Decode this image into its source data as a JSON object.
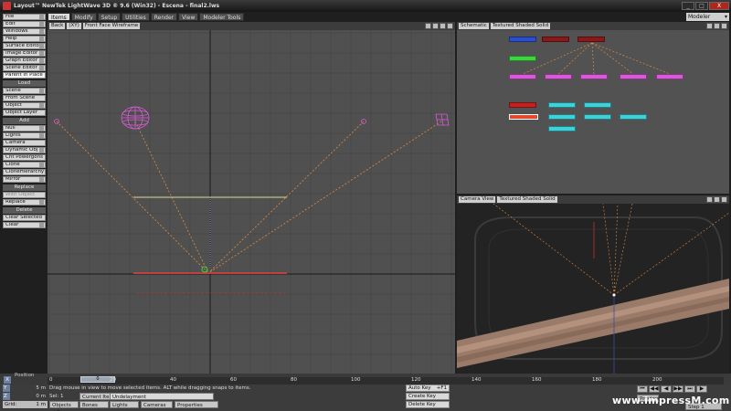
{
  "window": {
    "title": "Layout™ NewTek LightWave 3D ® 9.6  (Win32) - Escena - final2.lws",
    "buttons": [
      "_",
      "□",
      "X"
    ]
  },
  "tabs": [
    "Items",
    "Modify",
    "Setup",
    "Utilities",
    "Render",
    "View",
    "Modeler Tools"
  ],
  "modeler_dropdown": "Modeler",
  "left_toolbar": {
    "top": [
      "File",
      "Edit",
      "Windows",
      "Help",
      "Surface Editor",
      "Image Editor",
      "Graph Editor",
      "Scene Editor",
      "Parent in Place"
    ],
    "load_header": "Load",
    "load": [
      "Scene",
      "From Scene",
      "Object",
      "Object Layer"
    ],
    "add_header": "Add",
    "add": [
      "Null",
      "Lights",
      "Camera",
      "Dynamic Obj",
      "Cnt Powergons",
      "Clone",
      "CloneHierarchy",
      "Mirror"
    ],
    "replace_header": "Replace",
    "replace": [
      "With Object",
      "Replace"
    ],
    "delete_header": "Delete",
    "delete": [
      "Clear Selected",
      "Clear"
    ]
  },
  "main_viewport": {
    "view": "Back",
    "axis": "(XY)",
    "render_mode": "Front Face Wireframe"
  },
  "schematic_viewport": {
    "view": "Schematic",
    "render_mode": "Textured Shaded Solid"
  },
  "camera_viewport": {
    "view": "Camera View",
    "render_mode": "Textured Shaded Solid"
  },
  "timeline": {
    "label": "Position",
    "current_frame": "0",
    "ticks": [
      "0",
      "20",
      "40",
      "60",
      "80",
      "100",
      "120",
      "140",
      "160",
      "180",
      "200"
    ],
    "end_tick": "200"
  },
  "status": {
    "x_label": "X",
    "x_value": "0 m",
    "y_label": "Y",
    "y_value": "5 m",
    "z_label": "Z",
    "z_value": "0 m",
    "grid_label": "Grid:",
    "grid_value": "1 m",
    "message": "Drag mouse in view to move selected items. ALT while dragging snaps to items.",
    "sel_label": "Sel:",
    "sel_value": "1",
    "current_item_label": "Current Item",
    "current_item_value": "Undelayment",
    "objects_label": "Objects",
    "objects_value": "+O",
    "bones": "Bones",
    "lights": "Lights",
    "cameras": "Cameras",
    "properties": "Properties",
    "auto_key": "Auto Key",
    "auto_key_value": "+F1",
    "create_key": "Create Key",
    "delete_key": "Delete Key",
    "preview": "Preview",
    "step_label": "Step",
    "step_value": "1",
    "watermark": "www.impressM.com"
  },
  "colors": {
    "accent": "#d85ad8",
    "dash": "#e08a3c",
    "cyan_node": "#3fd0d8",
    "red_node": "#c42020"
  }
}
